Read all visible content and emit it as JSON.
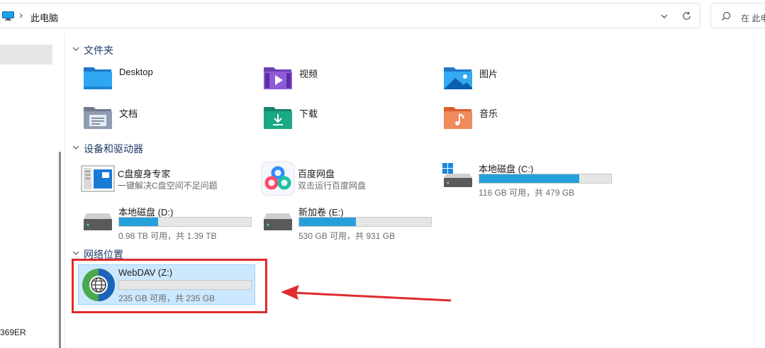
{
  "address_bar": {
    "crumb": "此电脑",
    "separator": "›",
    "search_placeholder": "在 此电"
  },
  "nav": {
    "bottom_item_text": "369ER"
  },
  "sections": {
    "folders": {
      "title": "文件夹"
    },
    "devices": {
      "title": "设备和驱动器"
    },
    "network": {
      "title": "网络位置"
    }
  },
  "folders": [
    {
      "name": "Desktop",
      "icon": "desktop-folder-icon"
    },
    {
      "name": "视频",
      "icon": "videos-folder-icon"
    },
    {
      "name": "图片",
      "icon": "pictures-folder-icon"
    },
    {
      "name": "文档",
      "icon": "documents-folder-icon"
    },
    {
      "name": "下载",
      "icon": "downloads-folder-icon"
    },
    {
      "name": "音乐",
      "icon": "music-folder-icon"
    }
  ],
  "devices": [
    {
      "name": "C盘瘦身专家",
      "desc": "一键解决C盘空间不足问题",
      "icon": "c-drive-cleaner-icon"
    },
    {
      "name": "百度网盘",
      "desc": "双击运行百度网盘",
      "icon": "baidu-netdisk-icon"
    },
    {
      "name": "本地磁盘 (C:)",
      "usage": "116 GB 可用，共 479 GB",
      "used_fraction": 0.758,
      "icon": "windows-drive-icon"
    },
    {
      "name": "本地磁盘 (D:)",
      "usage": "0.98 TB 可用，共 1.39 TB",
      "used_fraction": 0.295,
      "icon": "drive-icon"
    },
    {
      "name": "新加卷 (E:)",
      "usage": "530 GB 可用，共 931 GB",
      "used_fraction": 0.431,
      "icon": "drive-icon"
    }
  ],
  "network": [
    {
      "name": "WebDAV (Z:)",
      "usage": "235 GB 可用，共 235 GB",
      "used_fraction": 0.0,
      "icon": "network-drive-globe-icon"
    }
  ],
  "colors": {
    "usage_bar": "#26a0da",
    "selection": "#cce8ff",
    "annotation_red": "#e02b2b"
  }
}
